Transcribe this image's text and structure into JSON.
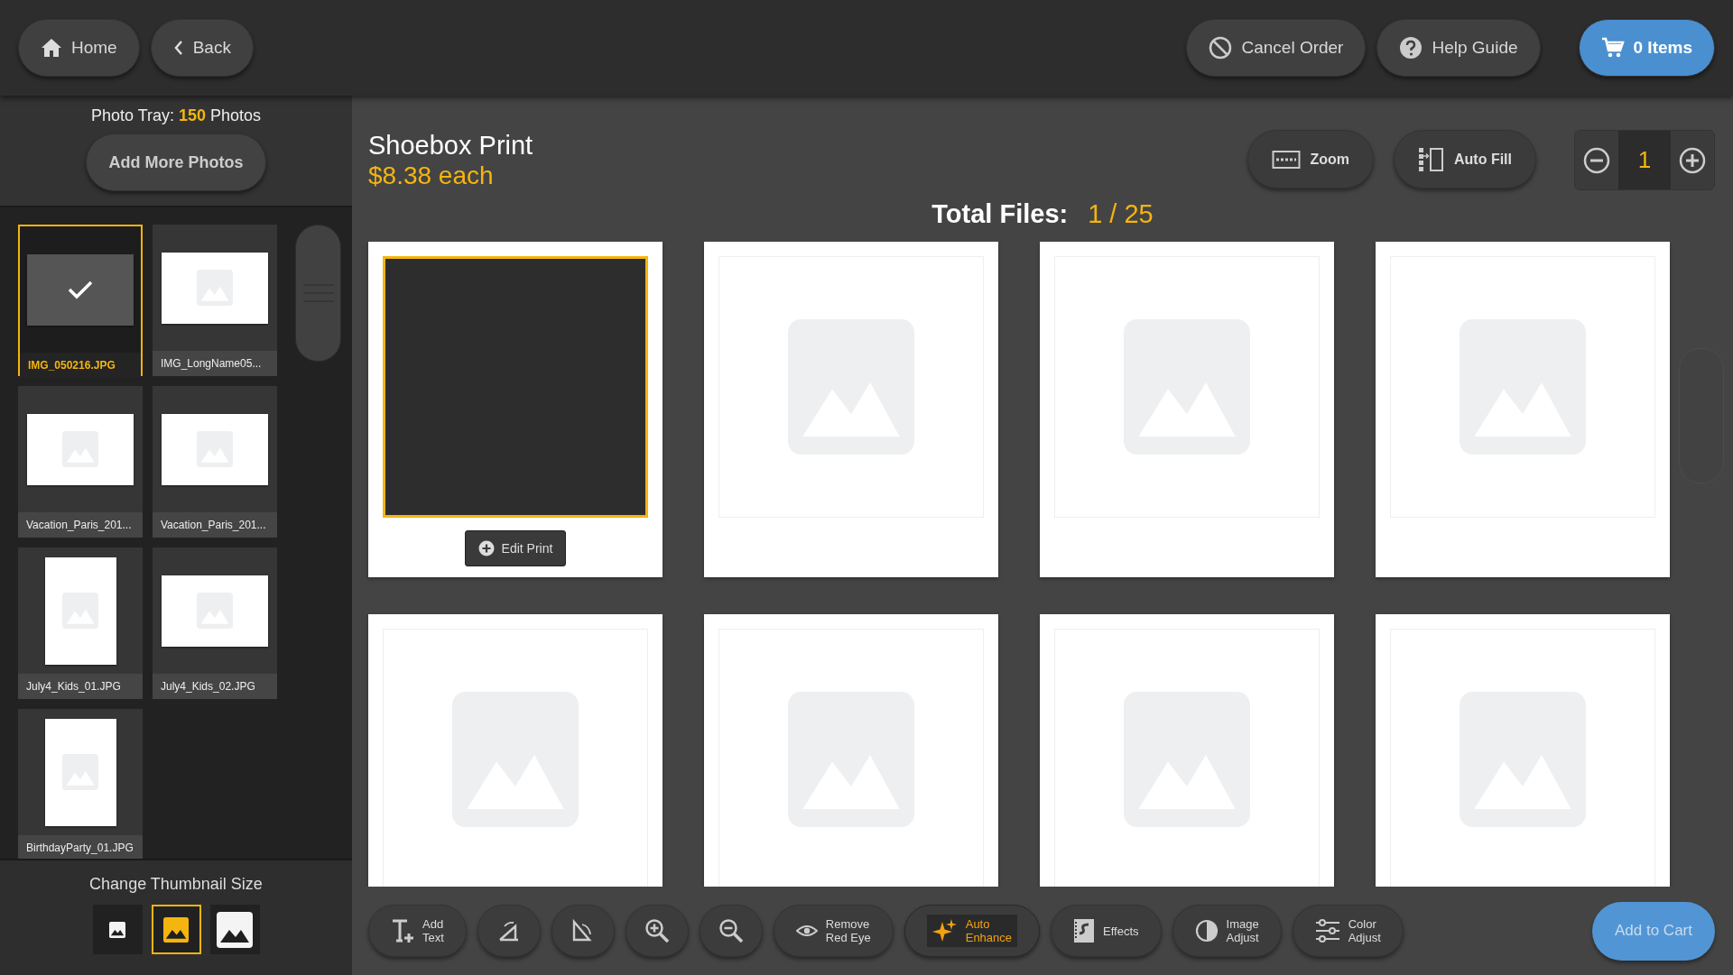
{
  "top_bar": {
    "left_buttons": [
      {
        "kind": "home",
        "label": "Home"
      },
      {
        "kind": "back",
        "label": "Back"
      }
    ],
    "right_buttons": [
      {
        "kind": "cancel",
        "label": "Cancel Order"
      },
      {
        "kind": "help",
        "label": "Help Guide"
      }
    ],
    "cart": {
      "label": "0 Items"
    }
  },
  "photo_tray": {
    "prefix": "Photo Tray:",
    "count": "150",
    "suffix": "Photos",
    "add_button": "Add More Photos",
    "photos": [
      {
        "name": "IMG_050216.JPG",
        "kind": "landscape",
        "selected": true
      },
      {
        "name": "IMG_LongName05...",
        "kind": "landscape",
        "selected": false
      },
      {
        "name": "Vacation_Paris_201...",
        "kind": "landscape",
        "selected": false
      },
      {
        "name": "Vacation_Paris_201...",
        "kind": "landscape",
        "selected": false
      },
      {
        "name": "July4_Kids_01.JPG",
        "kind": "portrait",
        "selected": false
      },
      {
        "name": "July4_Kids_02.JPG",
        "kind": "landscape",
        "selected": false
      },
      {
        "name": "BirthdayParty_01.JPG",
        "kind": "portrait",
        "selected": false
      }
    ],
    "thumbnail_size": {
      "label": "Change Thumbnail Size",
      "options": [
        {
          "kind": "small",
          "selected": false
        },
        {
          "kind": "medium",
          "selected": true
        },
        {
          "kind": "large",
          "selected": false
        }
      ]
    }
  },
  "product": {
    "title": "Shoebox Print",
    "price": "$8.38 each",
    "total_label": "Total Files:",
    "total_value": "1 / 25",
    "actions": [
      {
        "kind": "zoom",
        "label": "Zoom"
      },
      {
        "kind": "autofill",
        "label": "Auto Fill"
      }
    ],
    "quantity": "1"
  },
  "prints": [
    {
      "selected": true,
      "action": "Edit Print"
    },
    {
      "selected": false
    },
    {
      "selected": false
    },
    {
      "selected": false
    },
    {
      "selected": false
    },
    {
      "selected": false
    },
    {
      "selected": false
    },
    {
      "selected": false
    }
  ],
  "tools": [
    {
      "kind": "add-text",
      "lines": [
        "Add",
        "Text"
      ],
      "active": false
    },
    {
      "kind": "rotate-left",
      "active": false
    },
    {
      "kind": "rotate-right",
      "active": false
    },
    {
      "kind": "zoom-in",
      "active": false
    },
    {
      "kind": "zoom-out",
      "active": false
    },
    {
      "kind": "red-eye",
      "lines": [
        "Remove",
        "Red Eye"
      ],
      "active": false
    },
    {
      "kind": "enhance",
      "lines": [
        "Auto",
        "Enhance"
      ],
      "active": true
    },
    {
      "kind": "effects",
      "lines": [
        "Effects"
      ],
      "active": false
    },
    {
      "kind": "image-adjust",
      "lines": [
        "Image",
        "Adjust"
      ],
      "active": false
    },
    {
      "kind": "color-adjust",
      "lines": [
        "Color",
        "Adjust"
      ],
      "active": false
    }
  ],
  "add_to_cart": {
    "label": "Add to Cart",
    "disabled": true
  }
}
